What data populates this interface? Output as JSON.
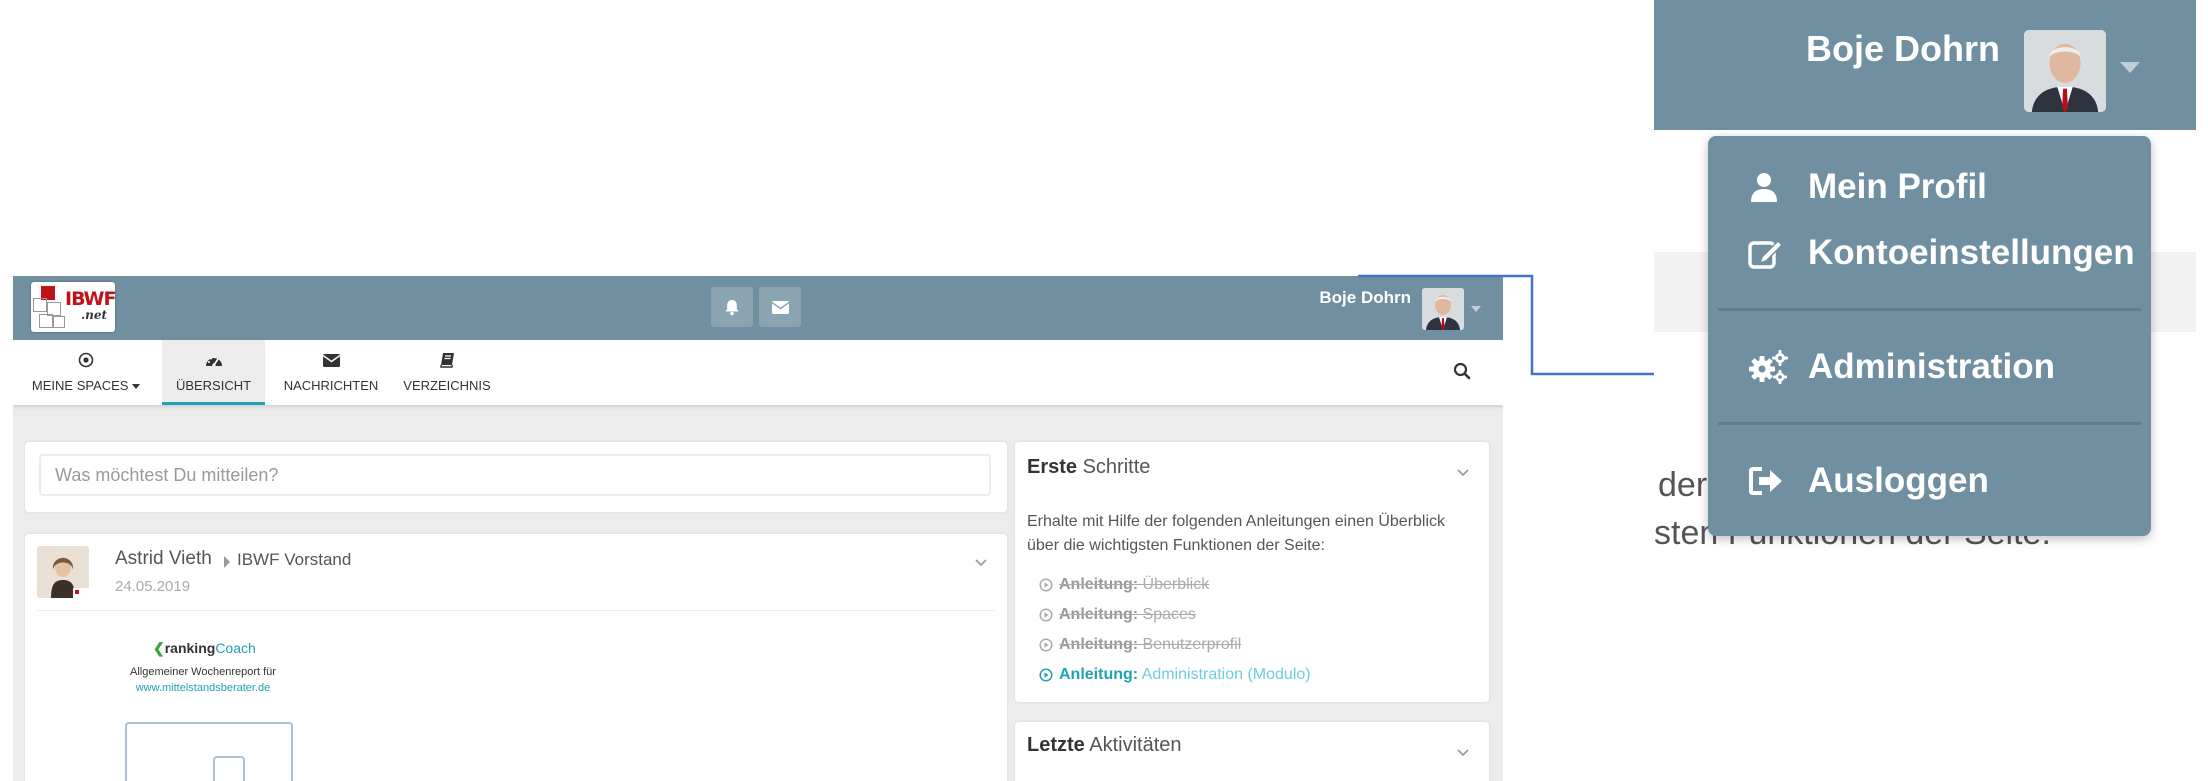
{
  "topbar": {
    "logo_text": "IBWF",
    "logo_sub": ".net",
    "user_name": "Boje Dohrn",
    "icons": [
      "bell-icon",
      "envelope-icon"
    ]
  },
  "nav": {
    "items": [
      {
        "label": "MEINE SPACES",
        "icon": "dot-circle-icon",
        "has_caret": true
      },
      {
        "label": "ÜBERSICHT",
        "icon": "dashboard-icon",
        "active": true
      },
      {
        "label": "NACHRICHTEN",
        "icon": "envelope-icon"
      },
      {
        "label": "VERZEICHNIS",
        "icon": "book-icon"
      }
    ],
    "search_icon": "search-icon"
  },
  "share": {
    "placeholder": "Was möchtest Du mitteilen?"
  },
  "post": {
    "author": "Astrid Vieth",
    "space": "IBWF Vorstand",
    "date": "24.05.2019",
    "brand_a": "ranking",
    "brand_b": "Coach",
    "line1": "Allgemeiner Wochenreport für",
    "line2": "www.mittelstandsberater.de"
  },
  "steps": {
    "title_bold": "Erste",
    "title_rest": "Schritte",
    "description": "Erhalte mit Hilfe der folgenden Anleitungen einen Überblick über die wichtigsten Funktionen der Seite:",
    "items": [
      {
        "prefix": "Anleitung:",
        "text": "Überblick",
        "done": true
      },
      {
        "prefix": "Anleitung:",
        "text": "Spaces",
        "done": true
      },
      {
        "prefix": "Anleitung:",
        "text": "Benutzerprofil",
        "done": true
      },
      {
        "prefix": "Anleitung:",
        "text": "Administration (Modulo)",
        "done": false
      }
    ]
  },
  "activities": {
    "title_bold": "Letzte",
    "title_rest": "Aktivitäten"
  },
  "zoom": {
    "user_name": "Boje Dohrn",
    "menu": [
      {
        "label": "Mein Profil",
        "icon": "user-icon"
      },
      {
        "label": "Kontoeinstellungen",
        "icon": "edit-icon"
      },
      {
        "label": "Administration",
        "icon": "cogs-icon"
      },
      {
        "label": "Ausloggen",
        "icon": "sign-out-icon"
      }
    ],
    "background_text_1": "der",
    "background_text_2": "sten Funktionen der Seite:"
  },
  "colors": {
    "bar": "#708fa0",
    "accent": "#21a1b3",
    "arrow": "#4472c4",
    "background": "#ececec"
  }
}
